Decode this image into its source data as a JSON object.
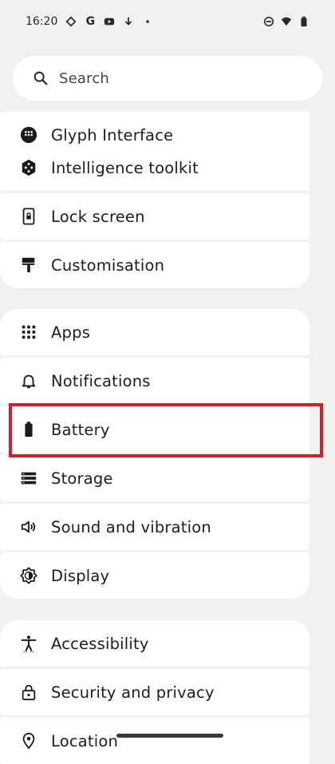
{
  "status_bar": {
    "time": "16:20",
    "left_icons": [
      "app-icon",
      "google-icon",
      "youtube-icon",
      "download-icon",
      "dot"
    ],
    "right_icons": [
      "do-not-disturb-icon",
      "wifi-icon",
      "battery-icon"
    ]
  },
  "search": {
    "placeholder": "Search"
  },
  "groups": [
    {
      "items": [
        {
          "label": "Glyph Interface",
          "icon": "glyph-icon"
        },
        {
          "label": "Intelligence toolkit",
          "icon": "intelligence-icon"
        },
        {
          "label": "Lock screen",
          "icon": "lock-screen-icon"
        },
        {
          "label": "Customisation",
          "icon": "paint-roller-icon"
        }
      ]
    },
    {
      "items": [
        {
          "label": "Apps",
          "icon": "apps-grid-icon"
        },
        {
          "label": "Notifications",
          "icon": "bell-icon"
        },
        {
          "label": "Battery",
          "icon": "battery-icon",
          "highlighted": true
        },
        {
          "label": "Storage",
          "icon": "storage-icon"
        },
        {
          "label": "Sound and vibration",
          "icon": "speaker-icon"
        },
        {
          "label": "Display",
          "icon": "brightness-icon"
        }
      ]
    },
    {
      "items": [
        {
          "label": "Accessibility",
          "icon": "accessibility-icon"
        },
        {
          "label": "Security and privacy",
          "icon": "lock-icon"
        },
        {
          "label": "Location",
          "icon": "location-pin-icon"
        }
      ]
    }
  ],
  "colors": {
    "background": "#f1f1f1",
    "card": "#ffffff",
    "highlight_border": "#d5202c"
  }
}
